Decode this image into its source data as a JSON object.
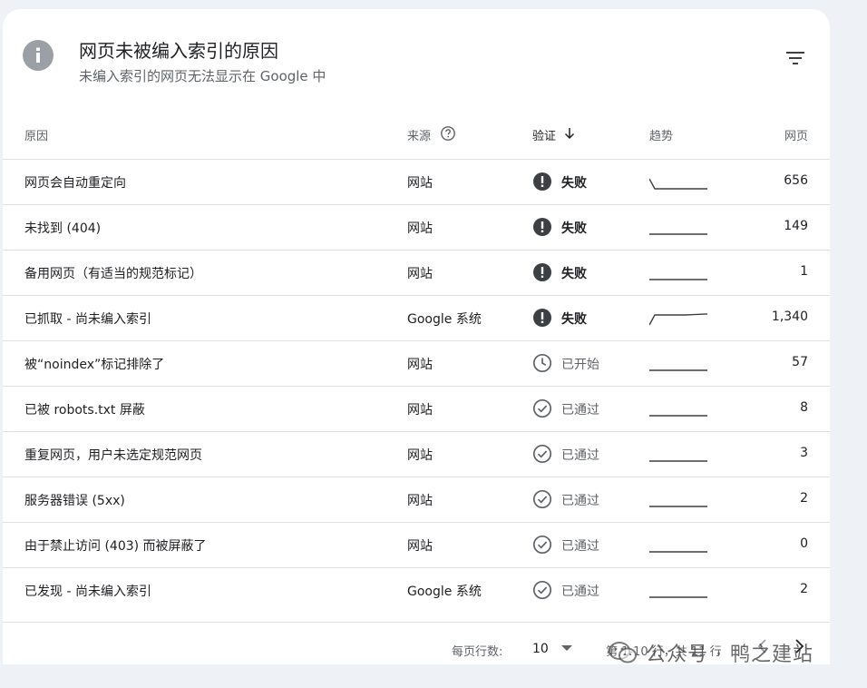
{
  "header": {
    "title": "网页未被编入索引的原因",
    "subtitle": "未编入索引的网页无法显示在 Google 中",
    "info_icon": "info-icon",
    "filter_icon": "filter-icon"
  },
  "table": {
    "columns": {
      "reason": "原因",
      "source": "来源",
      "verify": "验证",
      "trend": "趋势",
      "pages": "网页"
    },
    "rows": [
      {
        "reason": "网页会自动重定向",
        "source": "网站",
        "status": "失败",
        "status_type": "fail",
        "pages": "656",
        "trend": [
          3,
          1,
          1,
          1,
          1
        ]
      },
      {
        "reason": "未找到 (404)",
        "source": "网站",
        "status": "失败",
        "status_type": "fail",
        "pages": "149",
        "trend": [
          1,
          1,
          1,
          1,
          1
        ]
      },
      {
        "reason": "备用网页（有适当的规范标记）",
        "source": "网站",
        "status": "失败",
        "status_type": "fail",
        "pages": "1",
        "trend": [
          1,
          1,
          1,
          1,
          1
        ]
      },
      {
        "reason": "已抓取 - 尚未编入索引",
        "source": "Google 系统",
        "status": "失败",
        "status_type": "fail",
        "pages": "1,340",
        "trend": [
          1,
          3,
          3,
          3,
          3.2
        ]
      },
      {
        "reason": "被“noindex”标记排除了",
        "source": "网站",
        "status": "已开始",
        "status_type": "started",
        "pages": "57",
        "trend": [
          1,
          1,
          1,
          1,
          1
        ]
      },
      {
        "reason": "已被 robots.txt 屏蔽",
        "source": "网站",
        "status": "已通过",
        "status_type": "passed",
        "pages": "8",
        "trend": [
          1,
          1,
          1,
          1,
          1
        ]
      },
      {
        "reason": "重复网页，用户未选定规范网页",
        "source": "网站",
        "status": "已通过",
        "status_type": "passed",
        "pages": "3",
        "trend": [
          1,
          1,
          1,
          1,
          1
        ]
      },
      {
        "reason": "服务器错误 (5xx)",
        "source": "网站",
        "status": "已通过",
        "status_type": "passed",
        "pages": "2",
        "trend": [
          1,
          1,
          1,
          1,
          1
        ]
      },
      {
        "reason": "由于禁止访问 (403) 而被屏蔽了",
        "source": "网站",
        "status": "已通过",
        "status_type": "passed",
        "pages": "0",
        "trend": [
          1,
          1,
          1,
          1,
          1
        ]
      },
      {
        "reason": "已发现 - 尚未编入索引",
        "source": "Google 系统",
        "status": "已通过",
        "status_type": "passed",
        "pages": "2",
        "trend": [
          1,
          1,
          1,
          1,
          1
        ]
      }
    ]
  },
  "footer": {
    "rows_per_page_label": "每页行数:",
    "rows_per_page_value": "10",
    "range_text": "第 1-10 行，共 11 行"
  },
  "watermark": {
    "text": "公众号 · 鸭之建站"
  },
  "colors": {
    "fail_icon": "#3c4043",
    "muted_icon": "#5f6368",
    "trend_line": "#3c4043",
    "page_bg": "#eef2f7"
  }
}
